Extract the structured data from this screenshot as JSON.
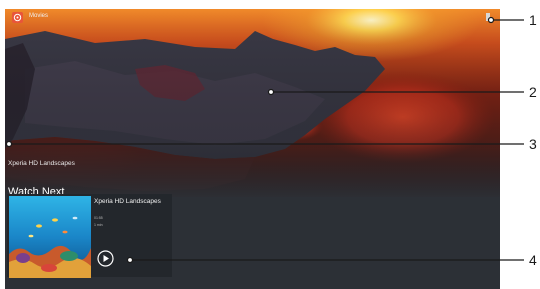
{
  "app": {
    "title": "Movies",
    "icon": "movies-icon",
    "menu_icon": "overflow-menu-icon"
  },
  "hero": {
    "video_title": "Xperia HD Landscapes"
  },
  "watch_next": {
    "heading": "Watch Next",
    "items": [
      {
        "title": "Xperia HD Landscapes",
        "meta_line_1": "01:55",
        "meta_line_2": "1 min",
        "play_icon": "play-icon"
      }
    ]
  },
  "callouts": {
    "labels": [
      "1",
      "2",
      "3",
      "4"
    ]
  },
  "colors": {
    "screen_bg": "#2c3036",
    "card_bg": "#23272c",
    "accent": "#e8553a"
  }
}
